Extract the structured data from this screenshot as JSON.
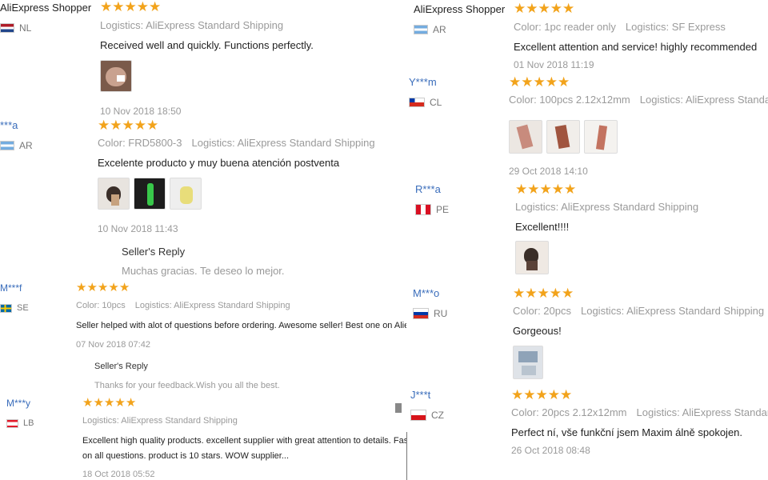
{
  "left_reviews": [
    {
      "name": "AliExpress Shopper",
      "country": "NL",
      "rating": 5,
      "meta": [
        "Logistics: AliExpress Standard Shipping"
      ],
      "text": "Received well and quickly. Functions perfectly.",
      "photos": 1,
      "date": "10 Nov 2018 18:50"
    },
    {
      "name": "***a",
      "country": "AR",
      "rating": 5,
      "meta": [
        "Color: FRD5800-3",
        "Logistics: AliExpress Standard Shipping"
      ],
      "text": "Excelente producto y muy buena atención postventa",
      "photos": 3,
      "date": "10 Nov 2018 11:43",
      "reply_title": "Seller's Reply",
      "reply_text": "Muchas gracias. Te deseo lo mejor."
    },
    {
      "name": "M***f",
      "country": "SE",
      "rating": 5,
      "meta": [
        "Color: 10pcs",
        "Logistics: AliExpress Standard Shipping"
      ],
      "text": "Seller helped with alot of questions before ordering. Awesome seller! Best one on Aliexpress.",
      "date": "07 Nov 2018 07:42",
      "reply_title": "Seller's Reply",
      "reply_text": "Thanks for your feedback.Wish you all the best."
    },
    {
      "name": "M***y",
      "country": "LB",
      "rating": 5,
      "meta": [
        "Logistics: AliExpress Standard Shipping"
      ],
      "text": "Excellent high quality products. excellent supplier with great attention to details. Fast rep",
      "text2": "on all questions. product is 10 stars. WOW supplier...",
      "date": "18 Oct 2018 05:52"
    }
  ],
  "right_reviews": [
    {
      "name": "AliExpress Shopper",
      "country": "AR",
      "rating": 5,
      "meta": [
        "Color: 1pc reader only",
        "Logistics: SF Express"
      ],
      "text": "Excellent attention and service! highly recommended",
      "date": "01 Nov 2018 11:19"
    },
    {
      "name": "Y***m",
      "country": "CL",
      "rating": 5,
      "meta": [
        "Color: 100pcs 2.12x12mm",
        "Logistics: AliExpress Standa"
      ],
      "photos": 3,
      "date": "29 Oct 2018 14:10"
    },
    {
      "name": "R***a",
      "country": "PE",
      "rating": 5,
      "meta": [
        "Logistics: AliExpress Standard Shipping"
      ],
      "text": "Excellent!!!!",
      "photos": 1
    },
    {
      "name": "M***o",
      "country": "RU",
      "rating": 5,
      "meta": [
        "Color: 20pcs",
        "Logistics: AliExpress Standard Shipping"
      ],
      "text": "Gorgeous!",
      "photos": 1
    },
    {
      "name": "J***t",
      "country": "CZ",
      "rating": 5,
      "meta": [
        "Color: 20pcs 2.12x12mm",
        "Logistics: AliExpress Standar"
      ],
      "text": "Perfect ní, vše funkční jsem Maxim álně spokojen.",
      "date": "26 Oct 2018 08:48"
    }
  ],
  "star_glyph": "★",
  "colors": {
    "star": "#f2a31b",
    "username": "#3a6dbb",
    "muted": "#9a9a9a"
  }
}
